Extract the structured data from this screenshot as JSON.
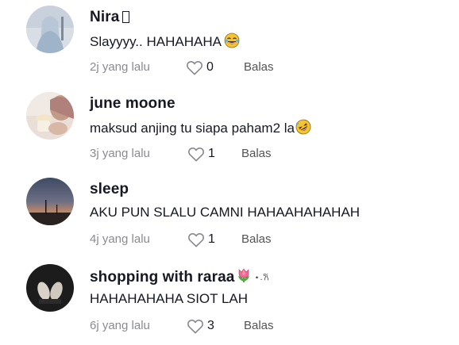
{
  "comments": [
    {
      "username": "Nira",
      "text": "Slayyyy.. HAHAHAHA",
      "time": "2j yang lalu",
      "likes": "0",
      "reply": "Balas",
      "emoji_icon": "tears-of-joy-emoji"
    },
    {
      "username": "june moone",
      "text": "maksud anjing tu siapa paham2 la",
      "time": "3j yang lalu",
      "likes": "1",
      "reply": "Balas",
      "emoji_icon": "rolling-on-floor-laughing-emoji"
    },
    {
      "username": "sleep",
      "text": "AKU PUN SLALU CAMNI HAHAAHAHAHAH",
      "time": "4j yang lalu",
      "likes": "1",
      "reply": "Balas"
    },
    {
      "username": "shopping with raraa",
      "username_suffix": "⋆.𐙚",
      "text": "HAHAHAHAHA SIOT LAH",
      "time": "6j yang lalu",
      "likes": "3",
      "reply": "Balas",
      "emoji_icon": "tulip-emoji"
    }
  ],
  "colors": {
    "text": "#161823",
    "meta": "#8a8b91",
    "reply": "#545454"
  }
}
